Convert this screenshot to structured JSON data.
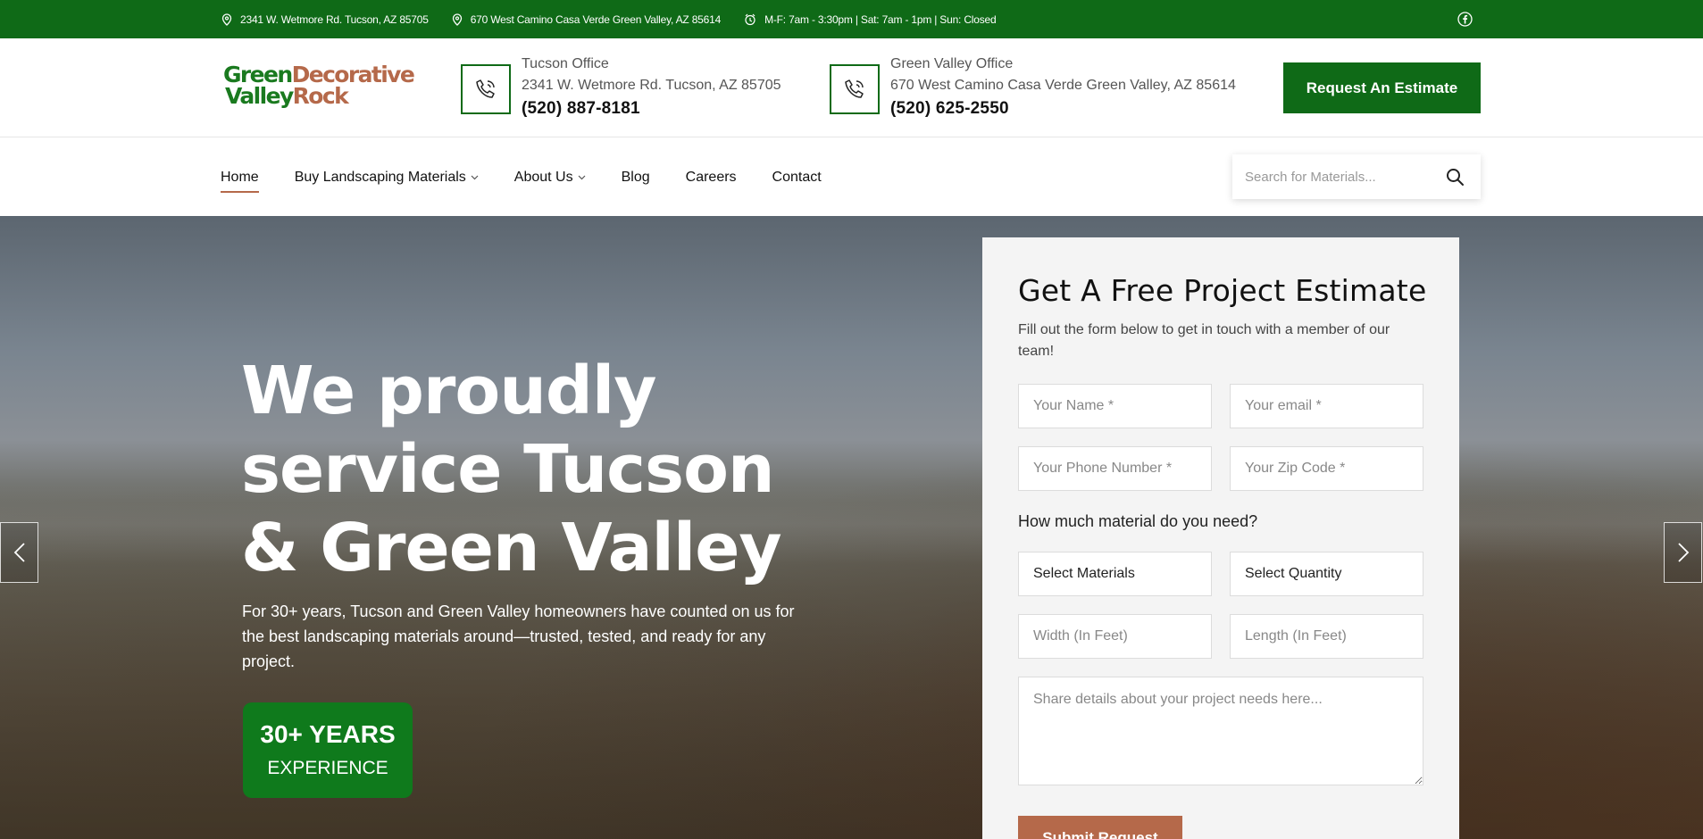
{
  "topbar": {
    "address1": "2341 W. Wetmore Rd. Tucson, AZ 85705",
    "address2": "670 West Camino Casa Verde Green Valley, AZ 85614",
    "hours": "M-F: 7am - 3:30pm | Sat: 7am - 1pm | Sun: Closed",
    "social_icon": "facebook-icon"
  },
  "logo": {
    "line1_a": "Green",
    "line1_b": "Decorative",
    "line2_a": "Valley",
    "line2_b": "Rock"
  },
  "offices": [
    {
      "name": "Tucson Office",
      "address": "2341 W. Wetmore Rd. Tucson, AZ 85705",
      "phone": "(520) 887-8181"
    },
    {
      "name": "Green Valley Office",
      "address": "670 West Camino Casa Verde Green Valley, AZ 85614",
      "phone": "(520) 625-2550"
    }
  ],
  "header": {
    "cta_label": "Request An Estimate"
  },
  "nav": {
    "items": [
      {
        "label": "Home",
        "active": true
      },
      {
        "label": "Buy Landscaping Materials",
        "dropdown": true
      },
      {
        "label": "About Us",
        "dropdown": true
      },
      {
        "label": "Blog"
      },
      {
        "label": "Careers"
      },
      {
        "label": "Contact"
      }
    ],
    "search_placeholder": "Search for Materials..."
  },
  "hero": {
    "title": "We proudly service Tucson & Green Valley",
    "subtitle": "For 30+ years, Tucson and Green Valley homeowners have counted on us for the best landscaping materials around—trusted, tested, and ready for any project.",
    "badge_top": "30+ YEARS",
    "badge_bottom": "EXPERIENCE"
  },
  "form": {
    "title": "Get A Free Project Estimate",
    "description": "Fill out the form below to get in touch with a member of our team!",
    "name_placeholder": "Your Name *",
    "email_placeholder": "Your email *",
    "phone_placeholder": "Your Phone Number *",
    "zip_placeholder": "Your Zip Code *",
    "question": "How much material do you need?",
    "materials_select": "Select Materials",
    "quantity_select": "Select Quantity",
    "width_placeholder": "Width (In Feet)",
    "length_placeholder": "Length (In Feet)",
    "details_placeholder": "Share details about your project needs here...",
    "submit_label": "Submit Request"
  },
  "colors": {
    "brand_green": "#0f6a17",
    "accent_brown": "#b5694a"
  }
}
